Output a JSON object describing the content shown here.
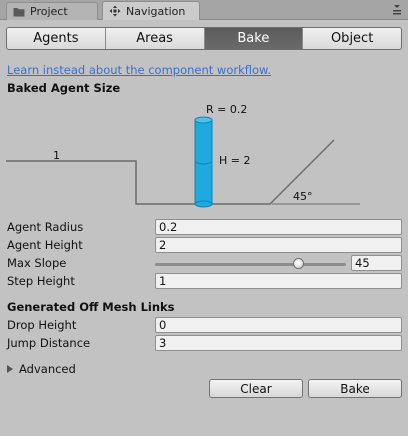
{
  "tabs": [
    {
      "label": "Project",
      "icon": "folder-icon"
    },
    {
      "label": "Navigation",
      "icon": "navigation-icon"
    }
  ],
  "toolbar": {
    "segments": [
      "Agents",
      "Areas",
      "Bake",
      "Object"
    ],
    "selected": "Bake"
  },
  "link_text": "Learn instead about the component workflow.",
  "baked_agent_size": {
    "header": "Baked Agent Size",
    "diagram": {
      "step_label": "1",
      "radius_label": "R = 0.2",
      "height_label": "H = 2",
      "slope_label": "45°"
    }
  },
  "fields": {
    "agent_radius": {
      "label": "Agent Radius",
      "value": "0.2"
    },
    "agent_height": {
      "label": "Agent Height",
      "value": "2"
    },
    "max_slope": {
      "label": "Max Slope",
      "value": "45",
      "fraction": 0.75
    },
    "step_height": {
      "label": "Step Height",
      "value": "1"
    }
  },
  "off_mesh": {
    "header": "Generated Off Mesh Links",
    "drop_height": {
      "label": "Drop Height",
      "value": "0"
    },
    "jump_distance": {
      "label": "Jump Distance",
      "value": "3"
    }
  },
  "advanced_label": "Advanced",
  "buttons": {
    "clear": "Clear",
    "bake": "Bake"
  },
  "colors": {
    "panel": "#c2c2c2",
    "agent": "#1ea9e1",
    "link": "#3a6fd0",
    "selected_segment": "#5f5f5f"
  }
}
